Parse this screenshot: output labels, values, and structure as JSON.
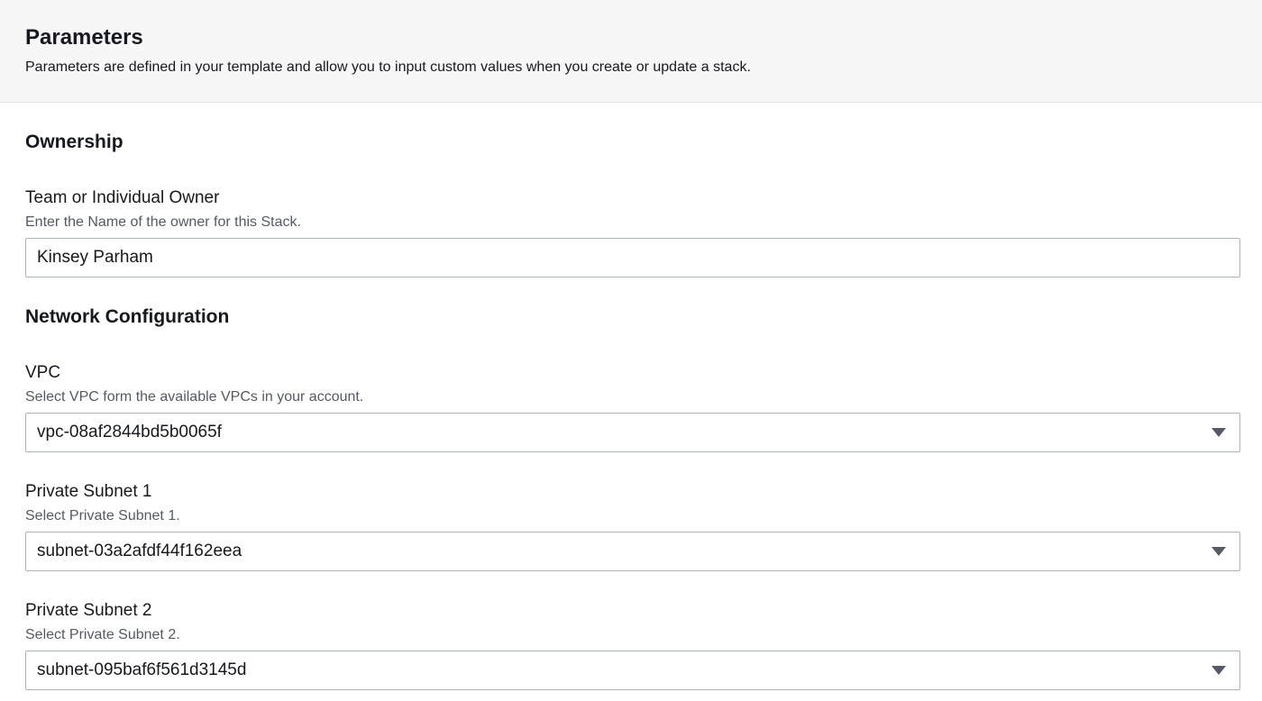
{
  "header": {
    "title": "Parameters",
    "description": "Parameters are defined in your template and allow you to input custom values when you create or update a stack."
  },
  "sections": {
    "ownership": {
      "title": "Ownership",
      "owner_field": {
        "label": "Team or Individual Owner",
        "description": "Enter the Name of the owner for this Stack.",
        "value": "Kinsey Parham"
      }
    },
    "network": {
      "title": "Network Configuration",
      "vpc": {
        "label": "VPC",
        "description": "Select VPC form the available VPCs in your account.",
        "value": "vpc-08af2844bd5b0065f",
        "icon": "caret-down-icon"
      },
      "subnet1": {
        "label": "Private Subnet 1",
        "description": "Select Private Subnet 1.",
        "value": "subnet-03a2afdf44f162eea",
        "icon": "caret-down-icon"
      },
      "subnet2": {
        "label": "Private Subnet 2",
        "description": "Select Private Subnet 2.",
        "value": "subnet-095baf6f561d3145d",
        "icon": "caret-down-icon"
      }
    }
  },
  "colors": {
    "header_bg": "#f7f7f7",
    "text": "#16191f",
    "secondary_text": "#545b64",
    "border": "#aab7b8"
  }
}
